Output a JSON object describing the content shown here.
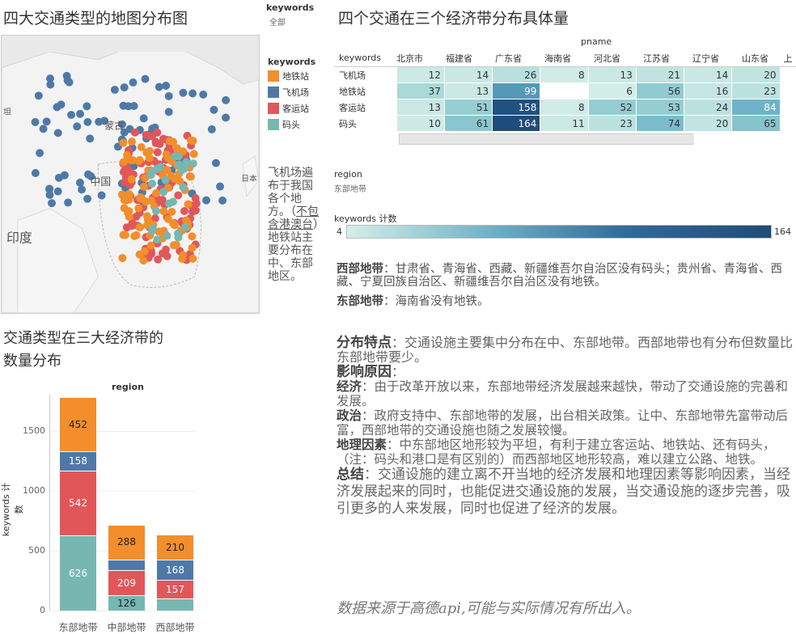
{
  "map_section": {
    "title": "四大交通类型的地图分布图",
    "labels": {
      "mongolia": "蒙古",
      "china": "中国",
      "japan": "日本",
      "india": "印度",
      "kazakh": "坦"
    },
    "filter_label": "keywords",
    "filter_value": "全部",
    "legend_title": "keywords",
    "legend": [
      {
        "label": "地铁站",
        "color": "#F28E2B"
      },
      {
        "label": "飞机场",
        "color": "#4E79A7"
      },
      {
        "label": "客运站",
        "color": "#E15759"
      },
      {
        "label": "码头",
        "color": "#76B7B2"
      }
    ],
    "note_a": "飞机场遍布于我国各个地方。（",
    "note_u": "不包含港澳台",
    "note_b": "）地铁站主要分布在中、东部地区。"
  },
  "heat_section": {
    "title": "四个交通在三个经济带分布具体量",
    "col_header": "pname",
    "row_header": "keywords",
    "columns": [
      "北京市",
      "福建省",
      "广东省",
      "海南省",
      "河北省",
      "江苏省",
      "辽宁省",
      "山东省",
      "上"
    ],
    "rows": [
      {
        "label": "飞机场",
        "values": [
          12,
          14,
          26,
          8,
          13,
          21,
          14,
          20,
          null
        ]
      },
      {
        "label": "地铁站",
        "values": [
          37,
          13,
          99,
          null,
          6,
          56,
          16,
          23,
          null
        ]
      },
      {
        "label": "客运站",
        "values": [
          13,
          51,
          158,
          8,
          52,
          53,
          24,
          84,
          null
        ]
      },
      {
        "label": "码头",
        "values": [
          10,
          61,
          164,
          11,
          23,
          74,
          20,
          65,
          null
        ]
      }
    ],
    "region_label": "region",
    "region_value": "东部地带",
    "scale_label": "keywords 计数",
    "scale_min": "4",
    "scale_max": "164",
    "note1_bold": "西部地带",
    "note1_text": "：甘肃省、青海省、西藏、新疆维吾尔自治区没有码头；贵州省、青海省、西藏、宁夏回族自治区、新疆维吾尔自治区没有地铁。",
    "note2_bold": "东部地带",
    "note2_text": "：海南省没有地铁。"
  },
  "bar_section": {
    "title_line1": "交通类型在三大经济带的",
    "title_line2": "数量分布",
    "chart_header": "region",
    "ylabel": "keywords 计数"
  },
  "chart_data": {
    "type": "bar",
    "stacked": true,
    "categories": [
      "东部地带",
      "中部地带",
      "西部地带"
    ],
    "series": [
      {
        "name": "码头",
        "color": "#76B7B2",
        "values": [
          626,
          126,
          98
        ]
      },
      {
        "name": "客运站",
        "color": "#E15759",
        "values": [
          542,
          209,
          157
        ]
      },
      {
        "name": "飞机场",
        "color": "#4E79A7",
        "values": [
          158,
          91,
          168
        ]
      },
      {
        "name": "地铁站",
        "color": "#F28E2B",
        "values": [
          452,
          288,
          210
        ]
      }
    ],
    "shown_labels": [
      [
        "626",
        "542",
        "158",
        "452"
      ],
      [
        "126",
        "209",
        "",
        "288"
      ],
      [
        "",
        "157",
        "168",
        "210"
      ]
    ],
    "yticks": [
      0,
      500,
      1000,
      1500
    ],
    "ylim": [
      0,
      1800
    ],
    "ylabel": "keywords 计数"
  },
  "analysis": {
    "p1_bold": "分布特点",
    "p1_text": "：交通设施主要集中分布在中、东部地带。西部地带也有分布但数量比东部地带要少。",
    "p2_bold": "影响原因",
    "p2_text": "：",
    "p3_bold": "经济",
    "p3_text": "：由于改革开放以来，东部地带经济发展越来越快，带动了交通设施的完善和发展。",
    "p4_bold": "政治",
    "p4_text": "：政府支持中、东部地带的发展，出台相关政策。让中、东部地带先富带动后富，西部地带的交通设施也随之发展较慢。",
    "p5_bold": "地理因素",
    "p5_text": "：中东部地区地形较为平坦，有利于建立客运站、地铁站、还有码头，（注：码头和港口是有区别的）而西部地区地形较高，难以建立公路、地铁。",
    "p6_bold": "总结",
    "p6_text": "：交通设施的建立离不开当地的经济发展和地理因素等影响因素，当经济发展起来的同时，也能促进交通设施的发展，当交通设施的逐步完善，吸引更多的人来发展，同时也促进了经济的发展。",
    "footer": "数据来源于高德api,可能与实际情况有所出入。"
  }
}
